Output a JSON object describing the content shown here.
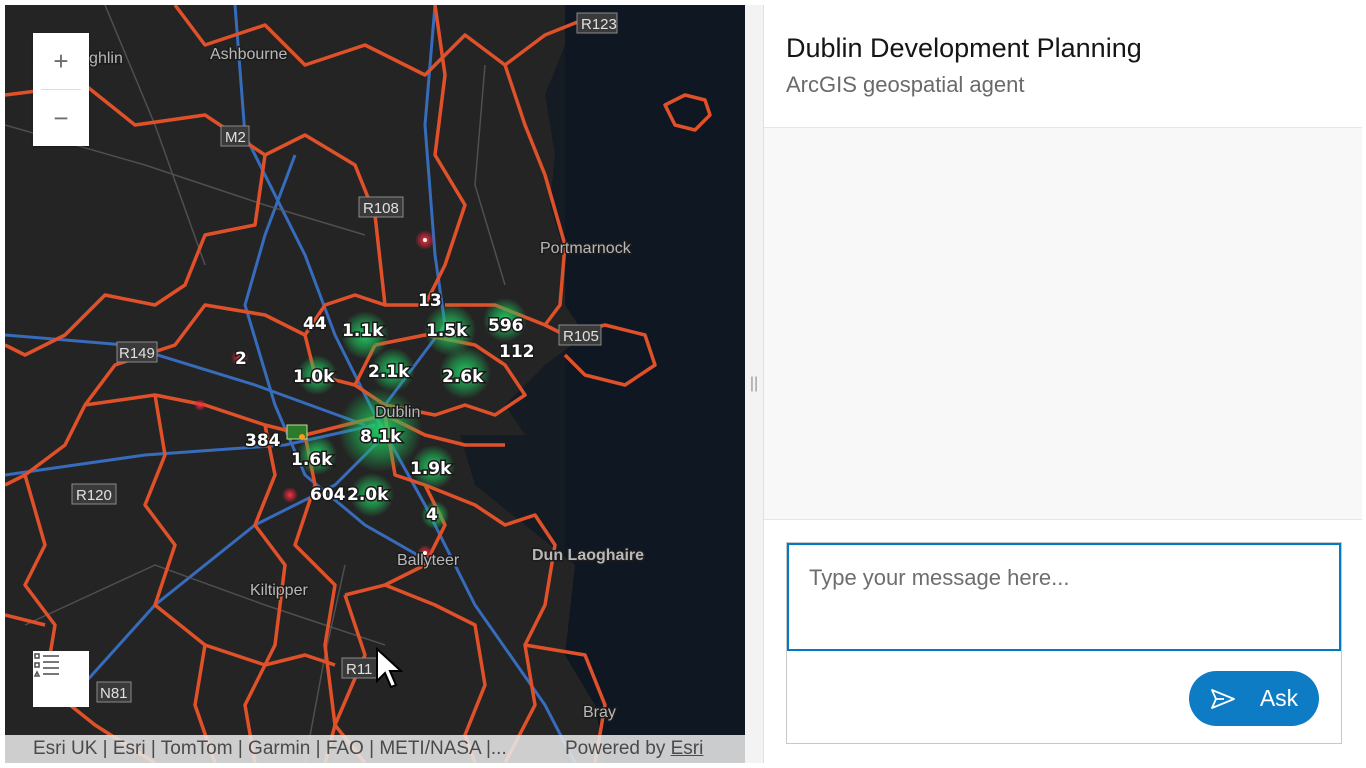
{
  "map": {
    "zoom_in": "+",
    "zoom_out": "−",
    "places": [
      "Dunboughlin",
      "Ashbourne",
      "Portmarnock",
      "Dublin",
      "Dun Laoghaire",
      "Kiltipper",
      "Ballyteer",
      "Bray"
    ],
    "roads": [
      "M2",
      "R108",
      "R105",
      "R149",
      "R120",
      "R11",
      "R123",
      "N81"
    ],
    "clusters": [
      "13",
      "44",
      "1.1k",
      "1.5k",
      "596",
      "112",
      "2",
      "1.0k",
      "2.1k",
      "2.6k",
      "384",
      "8.1k",
      "1.6k",
      "1.9k",
      "604",
      "2.0k",
      "4"
    ],
    "attribution": "Esri UK | Esri | TomTom | Garmin | FAO | METI/NASA |...",
    "powered_by": "Powered by",
    "powered_by_link": "Esri",
    "boundary_color": "#e0512a",
    "cluster_color": "#1fbf5a",
    "point_color": "#e0263a"
  },
  "panel": {
    "title": "Dublin Development Planning",
    "subtitle": "ArcGIS geospatial agent",
    "splitter": "||",
    "message_placeholder": "Type your message here...",
    "ask_label": "Ask"
  }
}
